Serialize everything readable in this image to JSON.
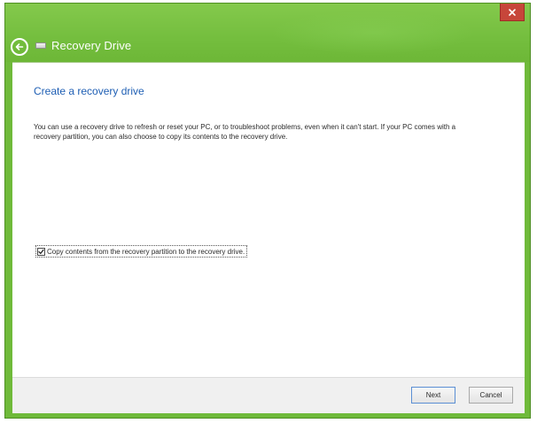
{
  "window": {
    "title": "Recovery Drive"
  },
  "titlebar": {
    "close_icon": "close-icon",
    "back_icon": "back-arrow-icon",
    "drive_icon": "drive-icon"
  },
  "main": {
    "heading": "Create a recovery drive",
    "description": "You can use a recovery drive to refresh or reset your PC, or to troubleshoot problems, even when it can't start. If your PC comes with a recovery partition, you can also choose to copy its contents to the recovery drive.",
    "checkbox": {
      "label": "Copy contents from the recovery partition to the recovery drive.",
      "checked": true
    }
  },
  "footer": {
    "next_label": "Next",
    "cancel_label": "Cancel"
  },
  "colors": {
    "titlebar": "#74be3e",
    "heading": "#1f5fb4",
    "close": "#c7463a"
  }
}
